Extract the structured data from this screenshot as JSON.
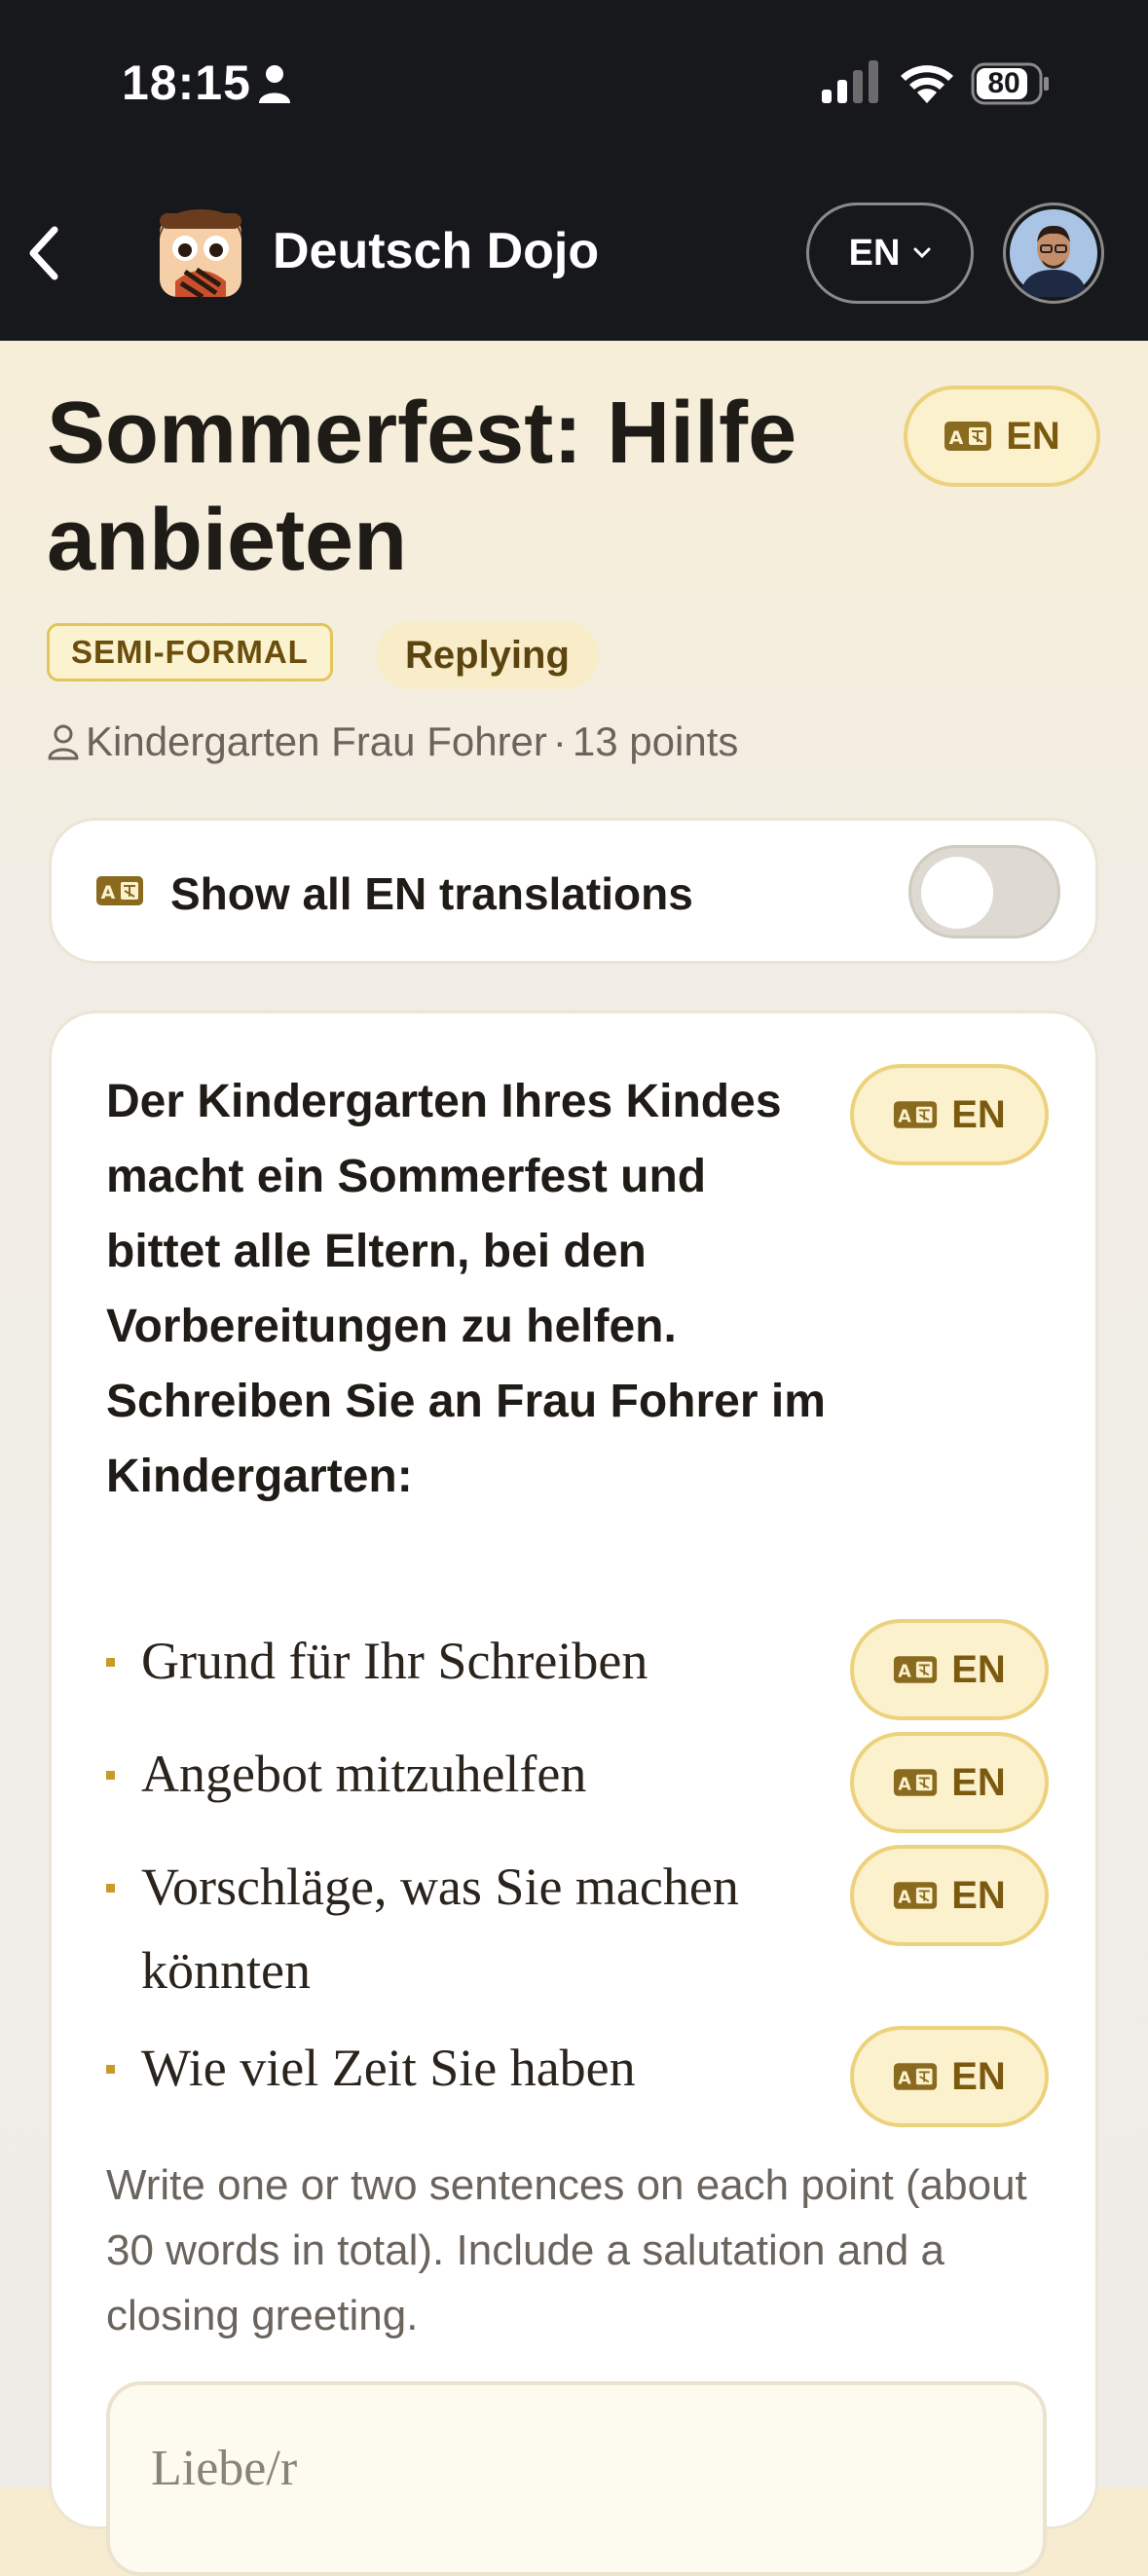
{
  "status_bar": {
    "time": "18:15",
    "battery": "80"
  },
  "nav": {
    "app_title": "Deutsch Dojo",
    "language": "EN"
  },
  "lesson": {
    "title": "Sommerfest: Hilfe anbieten",
    "translate_label": "EN",
    "tags": {
      "register": "SEMI-FORMAL",
      "mode": "Replying"
    },
    "recipient": "Kindergarten Frau Fohrer",
    "separator": "·",
    "points": "13 points"
  },
  "toggle": {
    "label": "Show all EN translations",
    "on": false
  },
  "task": {
    "prompt": "Der Kindergarten Ihres Kindes macht ein Sommerfest und bittet alle Eltern, bei den Vorbereitungen zu helfen. Schreiben Sie an Frau Fohrer im Kindergarten:",
    "bullets": [
      "Grund für Ihr Schreiben",
      "Angebot mitzuhelfen",
      "Vorschläge, was Sie machen könnten",
      "Wie viel Zeit Sie haben"
    ],
    "instructions": "Write one or two sentences on each point (about 30 words in total). Include a salutation and a closing greeting.",
    "answer_placeholder": "Liebe/r"
  },
  "colors": {
    "accent": "#ecd27c",
    "badge_bg": "#fbf1cd",
    "badge_text": "#7b5a10",
    "dark_bar": "#17181b"
  }
}
